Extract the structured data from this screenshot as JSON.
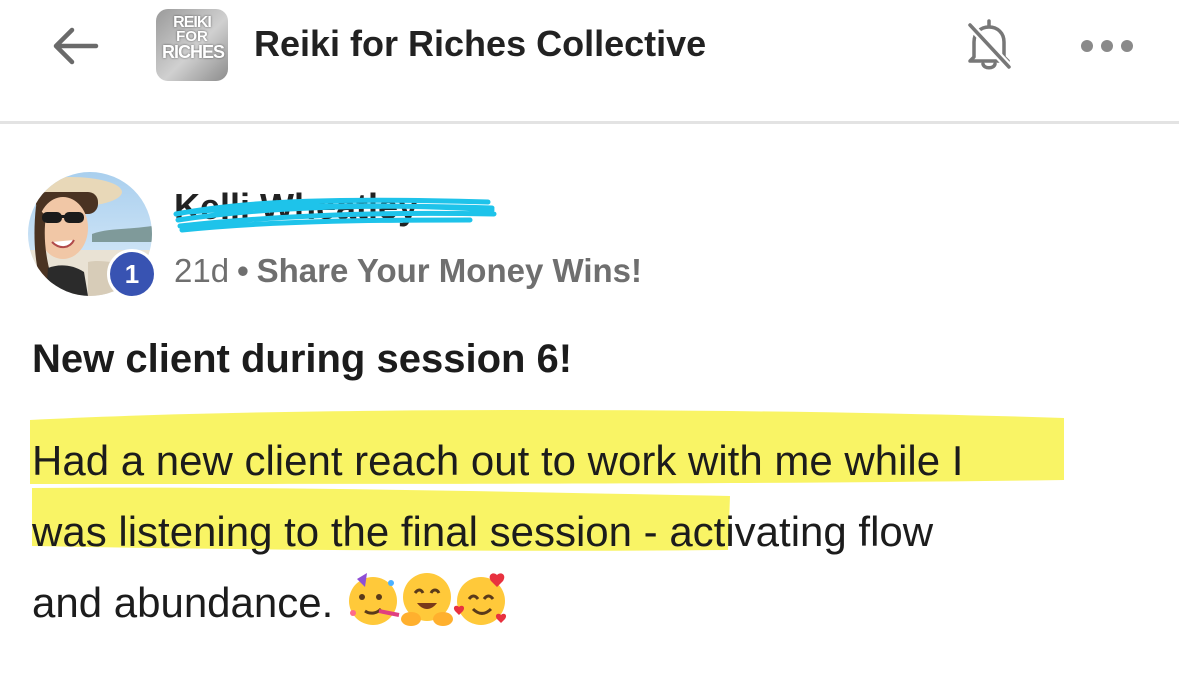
{
  "header": {
    "group_name": "Reiki for Riches Collective",
    "logo_text": [
      "REIKI",
      "FOR",
      "RICHES"
    ],
    "icons": [
      "arrow-left-icon",
      "bell-off-icon",
      "more-horizontal-icon"
    ]
  },
  "post": {
    "author": "Kelli Wheatley",
    "level_badge": "1",
    "time": "21d",
    "separator": "•",
    "category": "Share Your Money Wins!",
    "title": "New client during session 6!",
    "body_lines": [
      "Had a new client reach out to work with me while I",
      "was listening to the final session - activating flow",
      "and abundance."
    ],
    "emojis": [
      "partying-face-emoji",
      "hugging-face-emoji",
      "smiling-face-with-hearts-emoji"
    ],
    "highlight_color": "#f8f24a"
  },
  "colors": {
    "badge": "#3853b2",
    "redaction_scribble": "#1ec3ea",
    "meta_text": "#6f6f6f",
    "divider": "#e3e3e3"
  }
}
